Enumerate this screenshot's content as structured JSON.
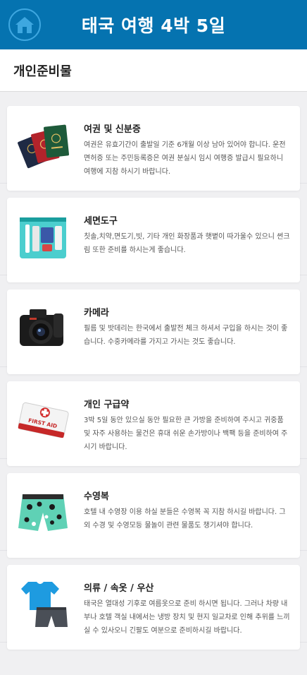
{
  "header": {
    "title": "태국 여행 4박 5일",
    "home_icon": "home-icon"
  },
  "section": {
    "title": "개인준비물"
  },
  "items": [
    {
      "title": "여권 및 신분증",
      "description": "여권은 유효기간이 출발일 기준 6개월 이상 남아 있어야 합니다. 운전면허증 또는 주민등록증은 여권 분실시 임시 여행증 발급시 필요하니 여행에 지참 하시기 바랍니다.",
      "image": "passports-image"
    },
    {
      "title": "세면도구",
      "description": "칫솔,치약,면도기,빗, 기타 개인 화장품과 햇볕이 따가울수 있으니 썬크림 또한 준비를 하시는게 좋습니다.",
      "image": "toiletries-bag-image"
    },
    {
      "title": "카메라",
      "description": "필름 및 밧데리는 한국에서 출발전 체크 하셔서 구입을 하시는 것이 좋습니다. 수중카메라를 가지고 가시는 것도 좋습니다.",
      "image": "camera-image"
    },
    {
      "title": "개인 구급약",
      "description": "3박 5일 동안 있으실 동안 필요한 큰 가방을 준비하여 주시고 귀중품 및 자주 사용하는 물건은 휴대 쉬운 손가방이나 백팩 등을 준비하여 주시기 바랍니다.",
      "image": "first-aid-kit-image",
      "image_text": "FIRST AID"
    },
    {
      "title": "수영복",
      "description": "호텔 내 수영장 이용 하실 분들은 수영복 꼭 지참 하시길 바랍니다. 그 외 수경 및 수영모등 물놀이 관련 물품도 챙기셔야 합니다.",
      "image": "swim-shorts-image"
    },
    {
      "title": "의류 / 속옷 / 우산",
      "description": "태국은 열대성 기후로 여름옷으로 준비 하시면 됩니다. 그러나 차량 내부나 호텔 객실 내에서는 냉방 장치 및 현지 일교차로 인해 추위를 느끼실 수 있사오니 긴팔도 여분으로 준비하시길 바랍니다.",
      "image": "clothing-image"
    }
  ]
}
